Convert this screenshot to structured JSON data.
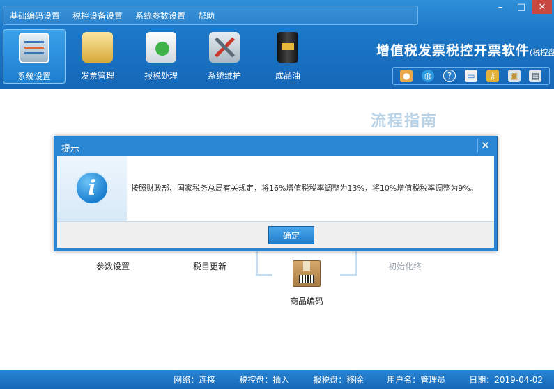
{
  "menu": [
    "基础编码设置",
    "税控设备设置",
    "系统参数设置",
    "帮助"
  ],
  "window_controls": {
    "minimize": "–",
    "maximize": "□",
    "close": "✕"
  },
  "toolbar": [
    {
      "label": "系统设置",
      "icon": "settings-panel-icon",
      "active": true
    },
    {
      "label": "发票管理",
      "icon": "folder-icon"
    },
    {
      "label": "报税处理",
      "icon": "tax-report-icon"
    },
    {
      "label": "系统维护",
      "icon": "tools-icon"
    },
    {
      "label": "成品油",
      "icon": "oil-barrel-icon"
    }
  ],
  "brand": {
    "main": "增值税发票税控开票软件",
    "sub": "(税控盘版)"
  },
  "quick_icons": [
    "user-icon",
    "globe-icon",
    "help-icon",
    "window-icon",
    "key-icon",
    "lock-icon",
    "calculator-icon"
  ],
  "guide": {
    "title": "流程指南",
    "steps": [
      "参数设置",
      "税目更新",
      "商品编码",
      "初始化终"
    ]
  },
  "status": {
    "network": "网络：连接",
    "tax_disk": "税控盘：插入",
    "report_disk": "报税盘：移除",
    "user": "用户名：管理员",
    "date": "日期：2019-04-02"
  },
  "dialog": {
    "title": "提示",
    "close": "✕",
    "message": "按照财政部、国家税务总局有关规定，将16%增值税税率调整为13%，将10%增值税税率调整为9%。",
    "ok": "确定"
  },
  "colors": {
    "accent": "#1c78c8",
    "dialog": "#2a86d3"
  }
}
